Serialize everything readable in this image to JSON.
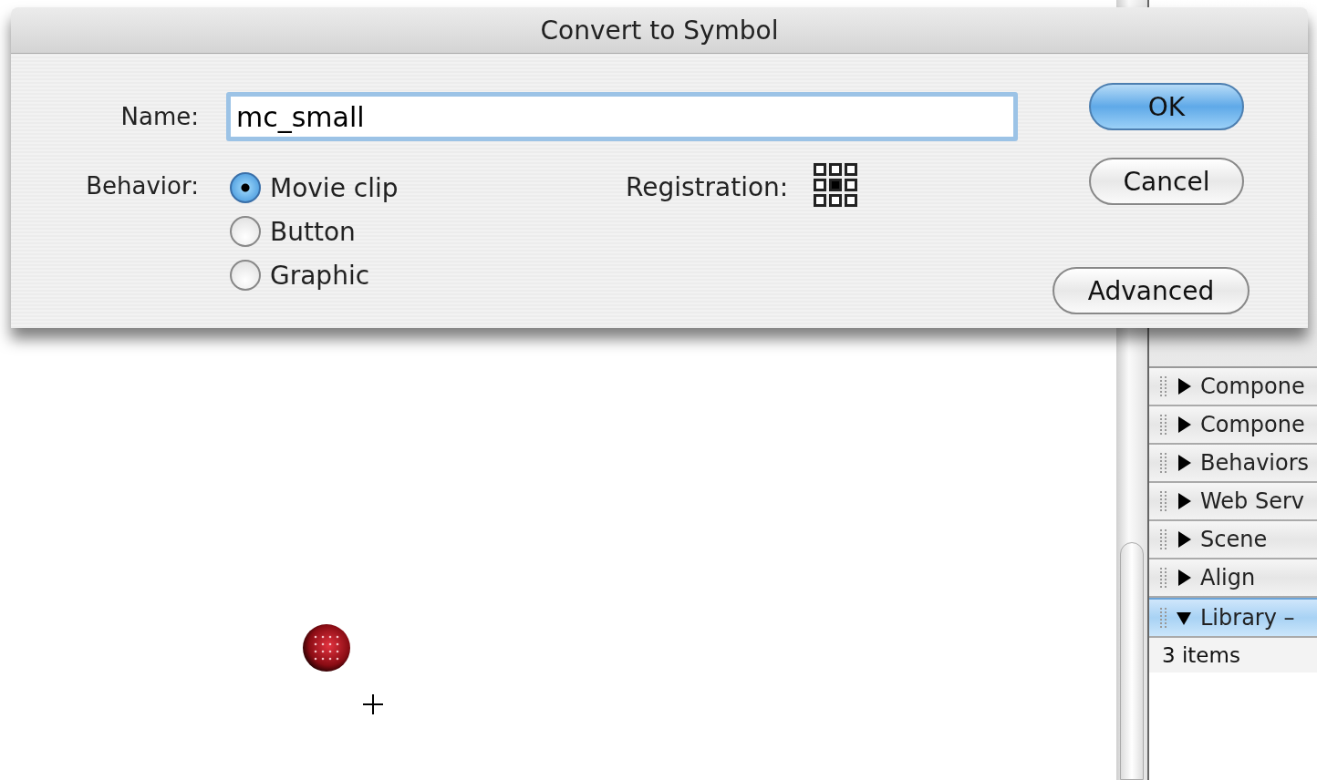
{
  "dialog": {
    "title": "Convert to Symbol",
    "name_field": {
      "label": "Name:",
      "value": "mc_small"
    },
    "behavior": {
      "label": "Behavior:",
      "options": [
        {
          "label": "Movie clip",
          "selected": true
        },
        {
          "label": "Button",
          "selected": false
        },
        {
          "label": "Graphic",
          "selected": false
        }
      ]
    },
    "registration": {
      "label": "Registration:",
      "points": [
        {
          "selected": false
        },
        {
          "selected": false
        },
        {
          "selected": false
        },
        {
          "selected": false
        },
        {
          "selected": true
        },
        {
          "selected": false
        },
        {
          "selected": false
        },
        {
          "selected": false
        },
        {
          "selected": false
        }
      ]
    },
    "buttons": [
      {
        "label": "OK",
        "kind": "default"
      },
      {
        "label": "Cancel",
        "kind": "normal"
      },
      {
        "label": "Advanced",
        "kind": "normal"
      }
    ]
  },
  "panels": [
    {
      "title": "Compone",
      "expanded": false
    },
    {
      "title": "Compone",
      "expanded": false
    },
    {
      "title": "Behaviors",
      "expanded": false
    },
    {
      "title": "Web Serv",
      "expanded": false
    },
    {
      "title": "Scene",
      "expanded": false
    },
    {
      "title": "Align",
      "expanded": false
    },
    {
      "title": "Library –",
      "expanded": true,
      "detail": "3 items"
    }
  ]
}
